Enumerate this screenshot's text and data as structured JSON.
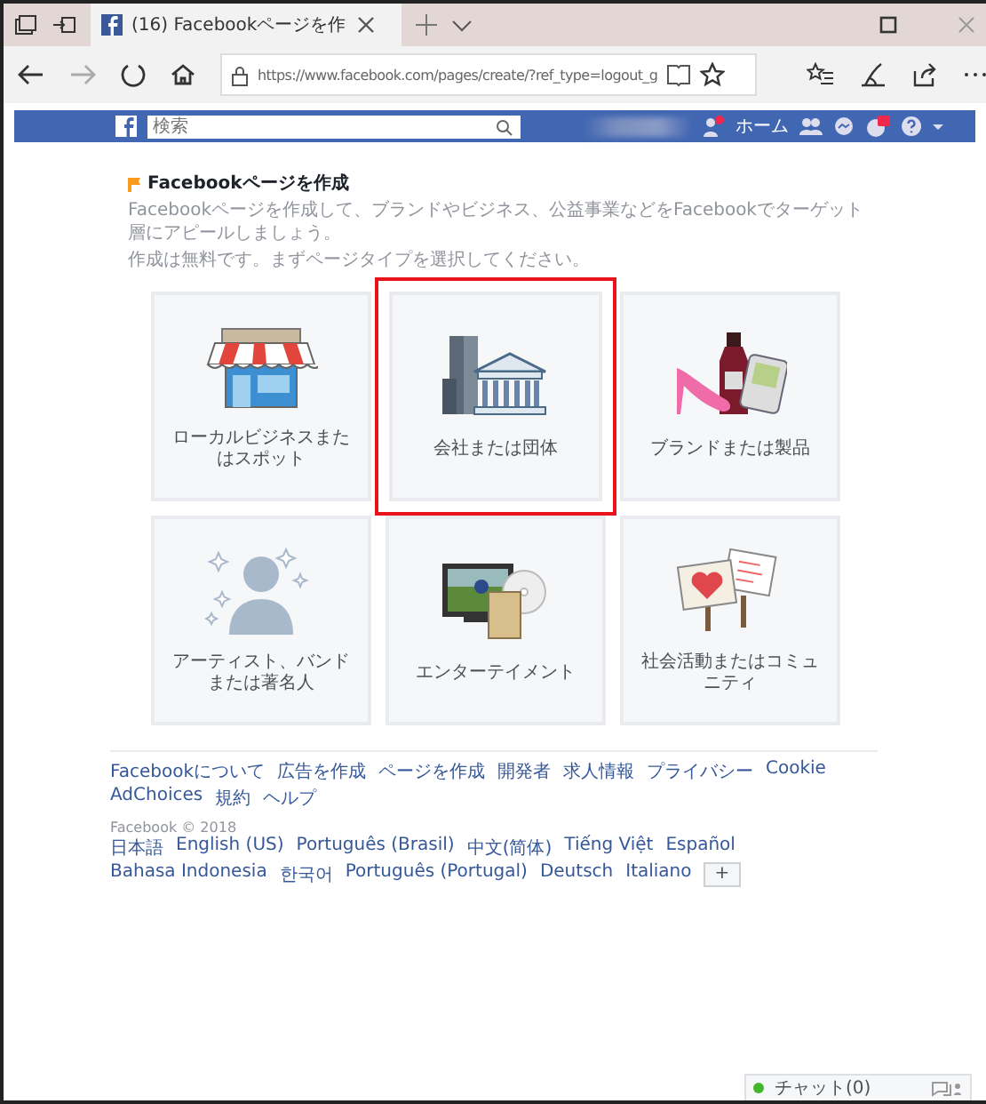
{
  "browser": {
    "tab_title": "(16) Facebookページを作",
    "url": "https://www.facebook.com/pages/create/?ref_type=logout_g"
  },
  "facebook_bar": {
    "search_placeholder": "検索",
    "home": "ホーム"
  },
  "create_page": {
    "title": "Facebookページを作成",
    "description": "Facebookページを作成して、ブランドやビジネス、公益事業などをFacebookでターゲット層にアピールしましょう。",
    "instruction": "作成は無料です。まずページタイプを選択してください。",
    "categories": [
      {
        "label": "ローカルビジネスまたはスポット",
        "kind": "store",
        "selected": false
      },
      {
        "label": "会社または団体",
        "kind": "company",
        "selected": true
      },
      {
        "label": "ブランドまたは製品",
        "kind": "brand",
        "selected": false
      },
      {
        "label": "アーティスト、バンドまたは著名人",
        "kind": "artist",
        "selected": false
      },
      {
        "label": "エンターテイメント",
        "kind": "entertainment",
        "selected": false
      },
      {
        "label": "社会活動またはコミュニティ",
        "kind": "community",
        "selected": false
      }
    ]
  },
  "footer": {
    "links": [
      "Facebookについて",
      "広告を作成",
      "ページを作成",
      "開発者",
      "求人情報",
      "プライバシー",
      "Cookie",
      "AdChoices",
      "規約",
      "ヘルプ"
    ],
    "copyright": "Facebook © 2018",
    "languages": [
      "日本語",
      "English (US)",
      "Português (Brasil)",
      "中文(简体)",
      "Tiếng Việt",
      "Español",
      "Bahasa Indonesia",
      "한국어",
      "Português (Portugal)",
      "Deutsch",
      "Italiano"
    ],
    "more_languages": "+"
  },
  "chat": {
    "label": "チャット(0)"
  }
}
